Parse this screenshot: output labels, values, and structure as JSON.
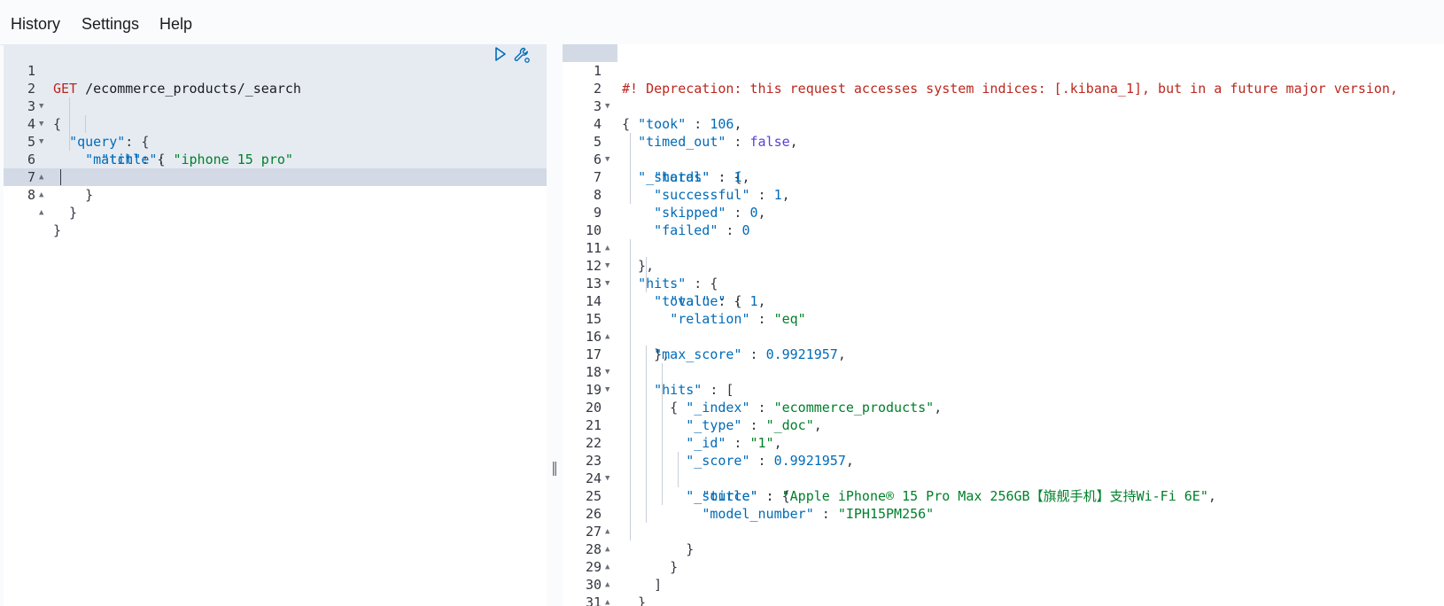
{
  "menu": {
    "history": "History",
    "settings": "Settings",
    "help": "Help"
  },
  "request": {
    "lines": [
      "GET /ecommerce_products/_search",
      "{",
      "  \"query\": {",
      "    \"match\": {",
      "      \"title\": \"iphone 15 pro\"",
      "    }",
      "  }",
      "}"
    ],
    "line_numbers": [
      "1",
      "2",
      "3",
      "4",
      "5",
      "6",
      "7",
      "8"
    ]
  },
  "response": {
    "line_numbers": [
      "1",
      "2",
      "3",
      "4",
      "5",
      "6",
      "7",
      "8",
      "9",
      "10",
      "11",
      "12",
      "13",
      "14",
      "15",
      "16",
      "17",
      "18",
      "19",
      "20",
      "21",
      "22",
      "23",
      "24",
      "25",
      "26",
      "27",
      "28",
      "29",
      "30",
      "31"
    ],
    "deprecation": "#! Deprecation: this request accesses system indices: [.kibana_1], but in a future major version,",
    "took": "106",
    "timed_out": "false",
    "shards_total": "1",
    "shards_successful": "1",
    "shards_skipped": "0",
    "shards_failed": "0",
    "hits_total_value": "1",
    "hits_total_relation": "\"eq\"",
    "max_score": "0.9921957",
    "doc_index": "\"ecommerce_products\"",
    "doc_type": "\"_doc\"",
    "doc_id": "\"1\"",
    "doc_score": "0.9921957",
    "doc_title": "\"Apple iPhone® 15 Pro Max 256GB【旗舰手机】支持Wi-Fi 6E\"",
    "doc_model_number": "\"IPH15PM256\""
  },
  "resizer_glyph": "‖",
  "colors": {
    "method": "#bd271e",
    "key": "#006bb8",
    "string": "#00802b",
    "number": "#006bb8",
    "boolean": "#5a3fd6",
    "warning": "#bd271e",
    "request_bg": "#e6ebf2",
    "active_line_bg": "#d3dae6"
  }
}
